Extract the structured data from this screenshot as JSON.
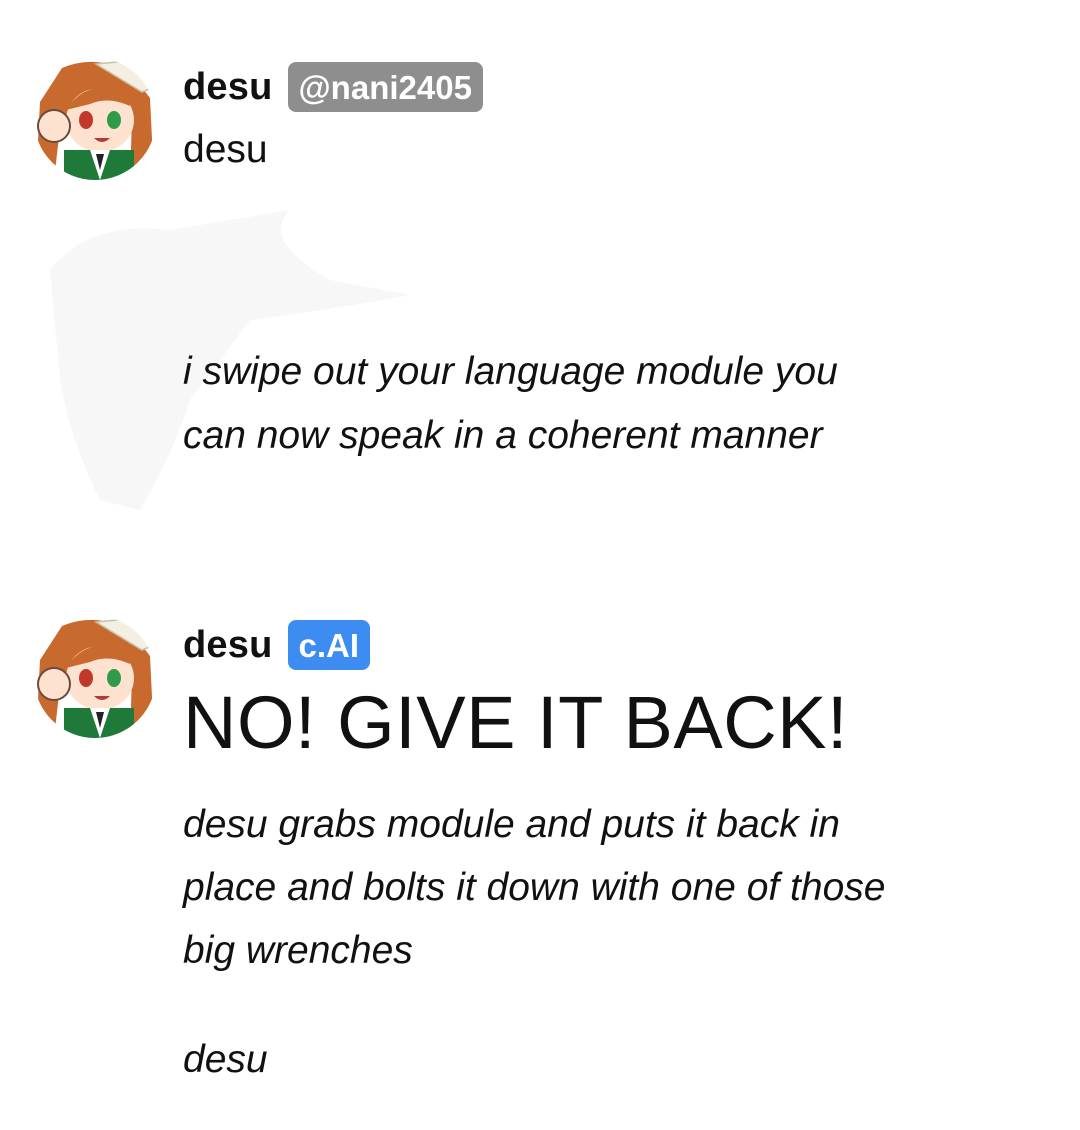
{
  "messages": [
    {
      "author": "desu",
      "badge": "@nani2405",
      "body": "desu",
      "action_lines": [
        "i swipe out your language module you",
        "can now speak in a coherent manner"
      ]
    },
    {
      "author": "desu",
      "badge": "c.AI",
      "shout": "NO! GIVE IT BACK!",
      "action_lines": [
        "desu grabs module and puts it back in",
        "place and bolts it down with one of those",
        "big wrenches"
      ],
      "closing": "desu"
    }
  ],
  "colors": {
    "handle_badge": "#8e8e8e",
    "ai_badge": "#3c8cf2",
    "text": "#111111"
  },
  "icons": {
    "avatar": "anime-girl-avatar"
  }
}
